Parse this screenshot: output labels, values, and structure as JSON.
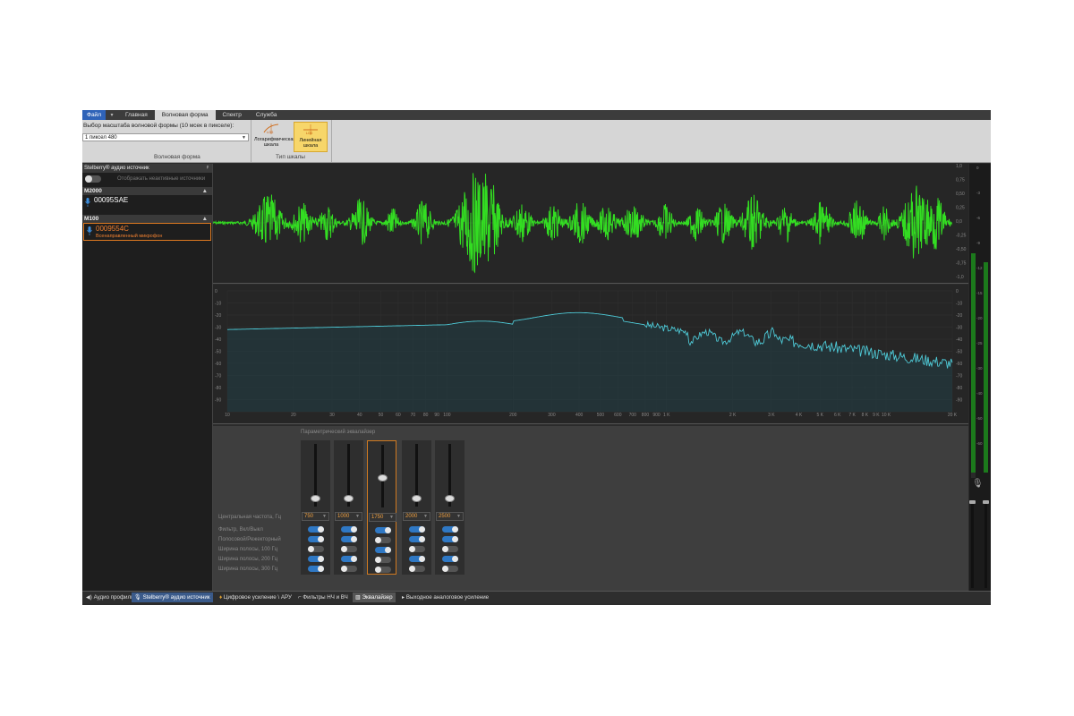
{
  "menu": {
    "file": "Файл",
    "tabs": [
      "Главная",
      "Волновая форма",
      "Спектр",
      "Служба"
    ],
    "active_tab": "Волновая форма"
  },
  "ribbon": {
    "zoom_label": "Выбор масштаба волновой формы (10 мсек в пикселе):",
    "zoom_value": "1 пиксел 480",
    "group1_caption": "Волновая форма",
    "log_scale": "Логарифмическая шкала",
    "linear_scale": "Линейная шкала",
    "group2_caption": "Тип шкалы",
    "icon_text": "LOG"
  },
  "left_panel": {
    "title": "Stelberry® аудио источник",
    "show_inactive": "Отображать неактивные источники",
    "groups": [
      {
        "name": "M2000",
        "devices": [
          {
            "id": "00095SAE",
            "sub": ""
          }
        ]
      },
      {
        "name": "M100",
        "devices": [
          {
            "id": "0009554C",
            "sub": "Всенаправленный микрофон"
          }
        ]
      }
    ]
  },
  "waveform": {
    "scale_labels": [
      "1,0",
      "0,75",
      "0,50",
      "0,25",
      "0,0",
      "-0,25",
      "-0,50",
      "-0,75",
      "-1,0"
    ],
    "color": "#33dd22"
  },
  "spectrum": {
    "y_labels": [
      "0",
      "-10",
      "-20",
      "-30",
      "-40",
      "-50",
      "-60",
      "-70",
      "-80",
      "-90"
    ],
    "x_labels": [
      "10",
      "20",
      "30",
      "40",
      "50",
      "60",
      "70",
      "80",
      "90",
      "100",
      "200",
      "300",
      "400",
      "500",
      "600",
      "700",
      "800",
      "900",
      "1 K",
      "2 K",
      "3 K",
      "4 K",
      "5 K",
      "6 K",
      "7 K",
      "8 K",
      "9 K",
      "10 K",
      "20 K"
    ],
    "color": "#4ec9d6"
  },
  "right_meter": {
    "top_labels": [
      "0",
      "-3",
      "-6",
      "-9",
      "-12",
      "-15",
      "-20",
      "-25",
      "-30",
      "-40",
      "-50",
      "-60"
    ]
  },
  "equalizer": {
    "title": "Параметрический эквалайзер",
    "row_labels": {
      "center_freq": "Центральная частота, Гц",
      "filter": "Фильтр, Вкл/Выкл",
      "bandpass": "Полосовой/Режекторный",
      "bw100": "Ширина полосы, 100 Гц",
      "bw200": "Ширина полосы, 200 Гц",
      "bw300": "Ширина полосы, 300 Гц"
    },
    "bands": [
      {
        "freq": "750",
        "level": 0.1,
        "switches": [
          true,
          true,
          false,
          true,
          true
        ]
      },
      {
        "freq": "1000",
        "level": 0.1,
        "switches": [
          true,
          true,
          false,
          true,
          false
        ]
      },
      {
        "freq": "1750",
        "level": 0.45,
        "switches": [
          true,
          false,
          true,
          false,
          false
        ]
      },
      {
        "freq": "2000",
        "level": 0.1,
        "switches": [
          true,
          true,
          false,
          true,
          false
        ]
      },
      {
        "freq": "2500",
        "level": 0.1,
        "switches": [
          true,
          true,
          false,
          true,
          false
        ]
      }
    ]
  },
  "bottom_tabs": {
    "left": [
      "Аудио профиль",
      "Stelberry® аудио источник"
    ],
    "main": [
      "Цифровое усиление \\ АРУ",
      "Фильтры НЧ и ВЧ",
      "Эквалайзер",
      "Выходное аналоговое усиление"
    ]
  }
}
